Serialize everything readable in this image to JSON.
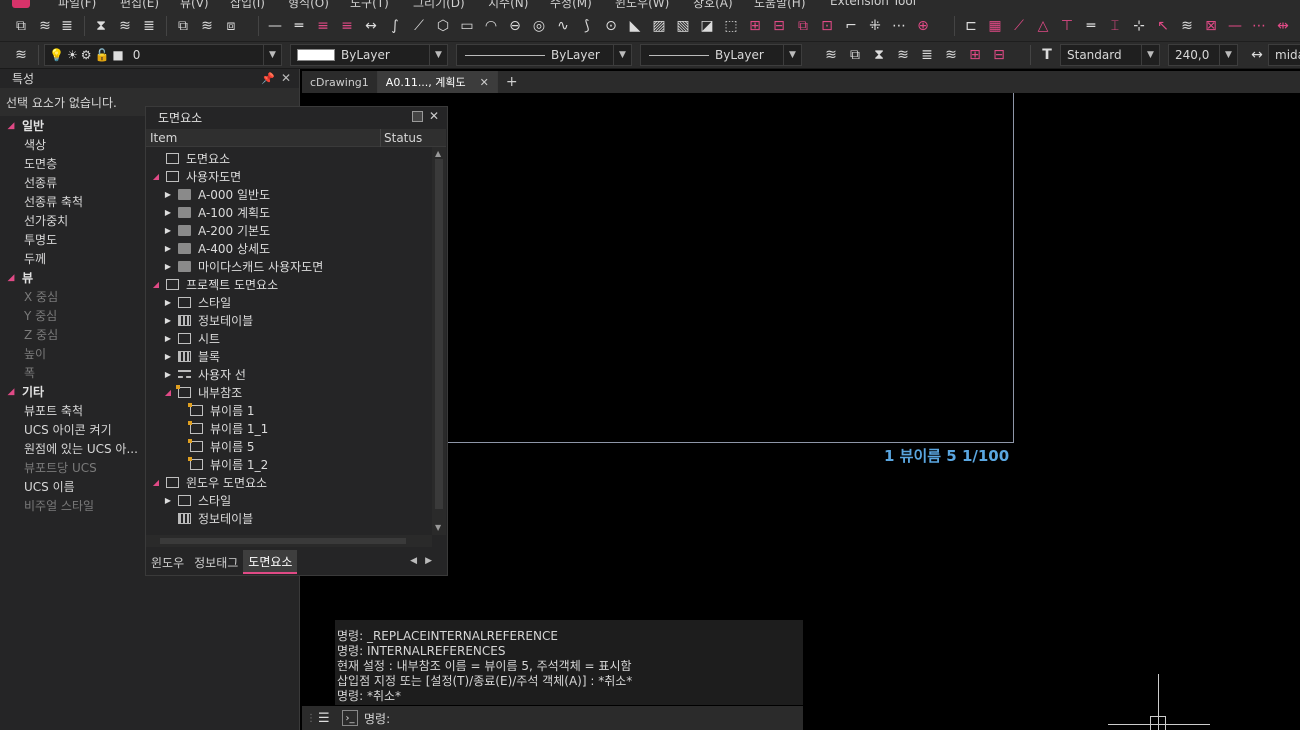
{
  "menu": [
    "파일(F)",
    "편집(E)",
    "뷰(V)",
    "삽입(I)",
    "형식(O)",
    "도구(T)",
    "그리기(D)",
    "치수(N)",
    "수정(M)",
    "윈도우(W)",
    "창호(A)",
    "도움말(H)",
    "Extension Tool"
  ],
  "toolbar2": {
    "layer_value": "0",
    "color_value": "ByLayer",
    "linetype_value": "ByLayer",
    "lineweight_value": "ByLayer",
    "textstyle_value": "Standard",
    "textsize_value": "240,0",
    "dimstyle_value": "mida"
  },
  "properties": {
    "title": "특성",
    "selection": "선택 요소가 없습니다.",
    "categories": [
      {
        "label": "일반",
        "items": [
          {
            "label": "색상",
            "dim": false
          },
          {
            "label": "도면층",
            "dim": false
          },
          {
            "label": "선종류",
            "dim": false
          },
          {
            "label": "선종류 축척",
            "dim": false
          },
          {
            "label": "선가중치",
            "dim": false
          },
          {
            "label": "투명도",
            "dim": false
          },
          {
            "label": "두께",
            "dim": false
          }
        ]
      },
      {
        "label": "뷰",
        "items": [
          {
            "label": "X 중심",
            "dim": true
          },
          {
            "label": "Y 중심",
            "dim": true
          },
          {
            "label": "Z 중심",
            "dim": true
          },
          {
            "label": "높이",
            "dim": true
          },
          {
            "label": "폭",
            "dim": true
          }
        ]
      },
      {
        "label": "기타",
        "items": [
          {
            "label": "뷰포트 축척",
            "dim": false
          },
          {
            "label": "UCS 아이콘 켜기",
            "dim": false
          },
          {
            "label": "원점에 있는 UCS 아...",
            "dim": false
          },
          {
            "label": "뷰포트당 UCS",
            "dim": true
          },
          {
            "label": "UCS 이름",
            "dim": false
          },
          {
            "label": "비주얼 스타일",
            "dim": true
          }
        ]
      }
    ]
  },
  "drawing_panel": {
    "title": "도면요소",
    "col_item": "Item",
    "col_status": "Status",
    "rows": [
      {
        "label": "도면요소",
        "level": 0,
        "arrow": "",
        "icon": "box"
      },
      {
        "label": "사용자도면",
        "level": 0,
        "arrow": "open",
        "icon": "box"
      },
      {
        "label": "A-000 일반도",
        "level": 1,
        "arrow": "closed",
        "icon": "folder"
      },
      {
        "label": "A-100 계획도",
        "level": 1,
        "arrow": "closed",
        "icon": "folder"
      },
      {
        "label": "A-200 기본도",
        "level": 1,
        "arrow": "closed",
        "icon": "folder"
      },
      {
        "label": "A-400 상세도",
        "level": 1,
        "arrow": "closed",
        "icon": "folder"
      },
      {
        "label": "마이다스캐드 사용자도면",
        "level": 1,
        "arrow": "closed",
        "icon": "folder"
      },
      {
        "label": "프로젝트 도면요소",
        "level": 0,
        "arrow": "open",
        "icon": "box"
      },
      {
        "label": "스타일",
        "level": 1,
        "arrow": "closed",
        "icon": "box"
      },
      {
        "label": "정보테이블",
        "level": 1,
        "arrow": "closed",
        "icon": "grid"
      },
      {
        "label": "시트",
        "level": 1,
        "arrow": "closed",
        "icon": "box"
      },
      {
        "label": "블록",
        "level": 1,
        "arrow": "closed",
        "icon": "grid"
      },
      {
        "label": "사용자 선",
        "level": 1,
        "arrow": "closed",
        "icon": "lines"
      },
      {
        "label": "내부참조",
        "level": 1,
        "arrow": "open",
        "icon": "view"
      },
      {
        "label": "뷰이름 1",
        "level": 2,
        "arrow": "",
        "icon": "view"
      },
      {
        "label": "뷰이름 1_1",
        "level": 2,
        "arrow": "",
        "icon": "view"
      },
      {
        "label": "뷰이름 5",
        "level": 2,
        "arrow": "",
        "icon": "view"
      },
      {
        "label": "뷰이름 1_2",
        "level": 2,
        "arrow": "",
        "icon": "view"
      },
      {
        "label": "윈도우 도면요소",
        "level": 0,
        "arrow": "open",
        "icon": "box"
      },
      {
        "label": "스타일",
        "level": 1,
        "arrow": "closed",
        "icon": "box"
      },
      {
        "label": "정보테이블",
        "level": 1,
        "arrow": "",
        "icon": "grid"
      }
    ],
    "tabs": [
      "윈도우",
      "정보태그",
      "도면요소"
    ],
    "active_tab": 2
  },
  "doc_tabs": [
    {
      "label": "cDrawing1",
      "active": false
    },
    {
      "label": "A0.11..., 계획도",
      "active": true
    }
  ],
  "viewport_label": "1 뷰이름 5 1/100",
  "command_history": [
    "명령: _REPLACEINTERNALREFERENCE",
    "명령: INTERNALREFERENCES",
    "현재 설정 : 내부참조 이름 = 뷰이름 5, 주석객체 = 표시함",
    "삽입점 지정 또는 [설정(T)/종료(E)/주석 객체(A)] : *취소*",
    "명령: *취소*"
  ],
  "command_prompt": "명령:",
  "colors": {
    "accent": "#e04a86",
    "viewport_label": "#5aa6e0",
    "panel": "#252526"
  }
}
